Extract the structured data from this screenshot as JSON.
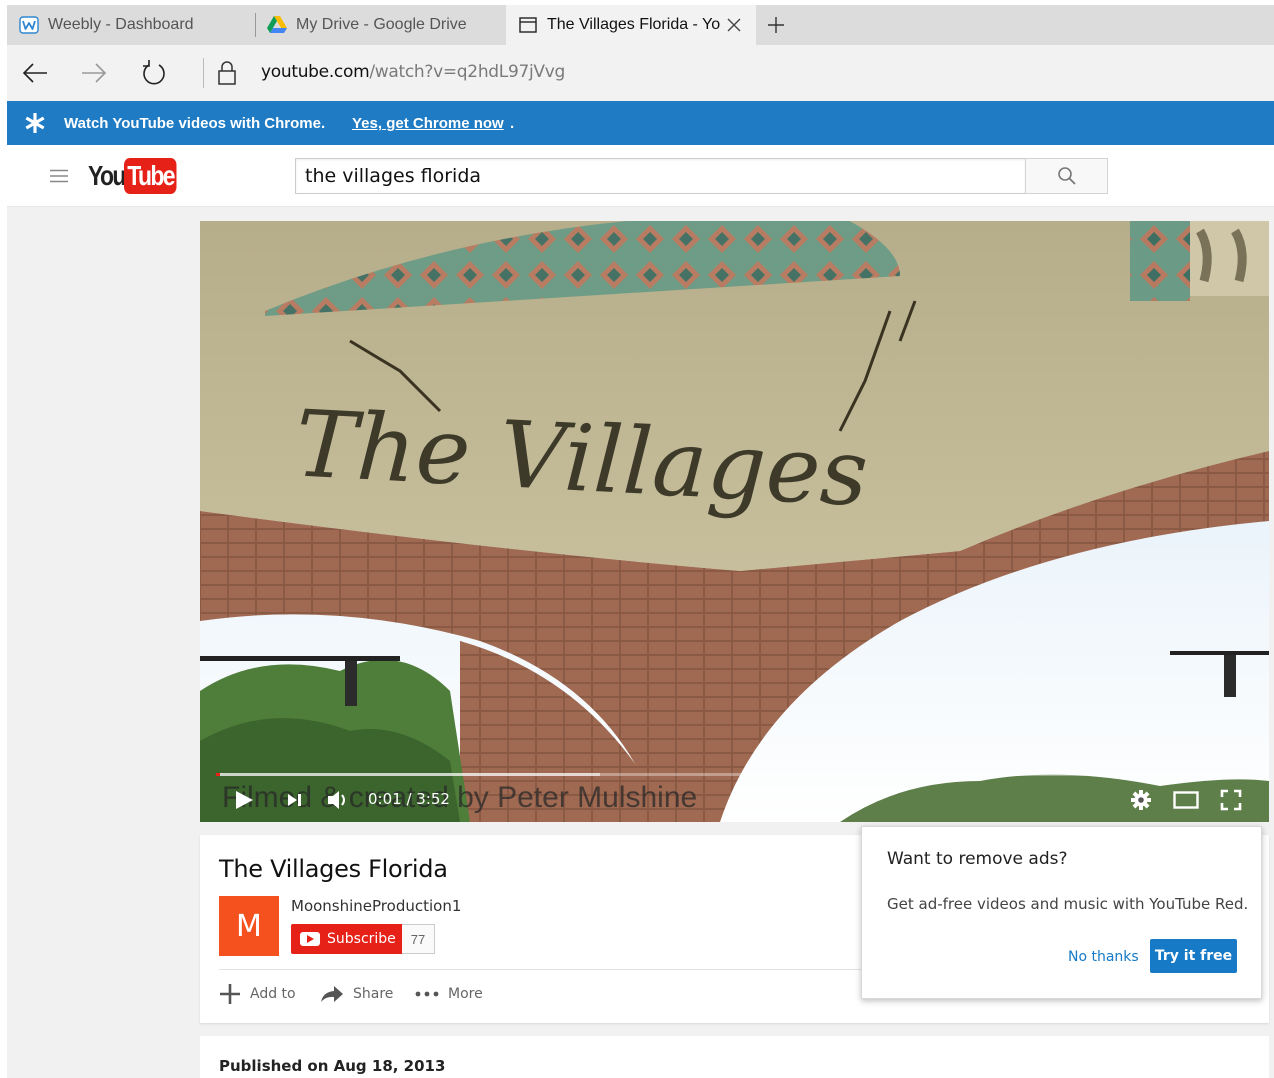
{
  "browser": {
    "tabs": [
      {
        "label": "Weebly - Dashboard",
        "icon": "weebly-icon"
      },
      {
        "label": "My Drive - Google Drive",
        "icon": "google-drive-icon"
      },
      {
        "label": "The Villages Florida - Yo",
        "icon": "page-icon",
        "active": true
      }
    ],
    "url_host": "youtube.com",
    "url_path": "/watch?v=q2hdL97jVvg"
  },
  "promo": {
    "message": "Watch YouTube videos with Chrome.",
    "link": "Yes, get Chrome now",
    "trailing": "."
  },
  "youtube": {
    "logo_you": "You",
    "logo_tube": "Tube",
    "search_value": "the villages florida"
  },
  "video": {
    "sign_text": "The Villages",
    "caption": "Filmed & created by Peter Mulshine",
    "time_current": "0:01",
    "time_total": "3:52",
    "time_display": "0:01 / 3:52",
    "progress_played": 0.003,
    "progress_loaded": 0.37
  },
  "info": {
    "title": "The Villages Florida",
    "avatar_letter": "M",
    "channel": "MoonshineProduction1",
    "subscribe": "Subscribe",
    "subscriber_count": "77",
    "actions": {
      "add_to": "Add to",
      "share": "Share",
      "more": "More"
    },
    "published": "Published on Aug 18, 2013"
  },
  "popup": {
    "title": "Want to remove ads?",
    "body": "Get ad-free videos and music with YouTube Red.",
    "no_thanks": "No thanks",
    "try_free": "Try it free"
  },
  "colors": {
    "youtube_red": "#e62117",
    "promo_blue": "#1e7bc4",
    "link_blue": "#167ac6",
    "avatar_orange": "#f4511e"
  }
}
